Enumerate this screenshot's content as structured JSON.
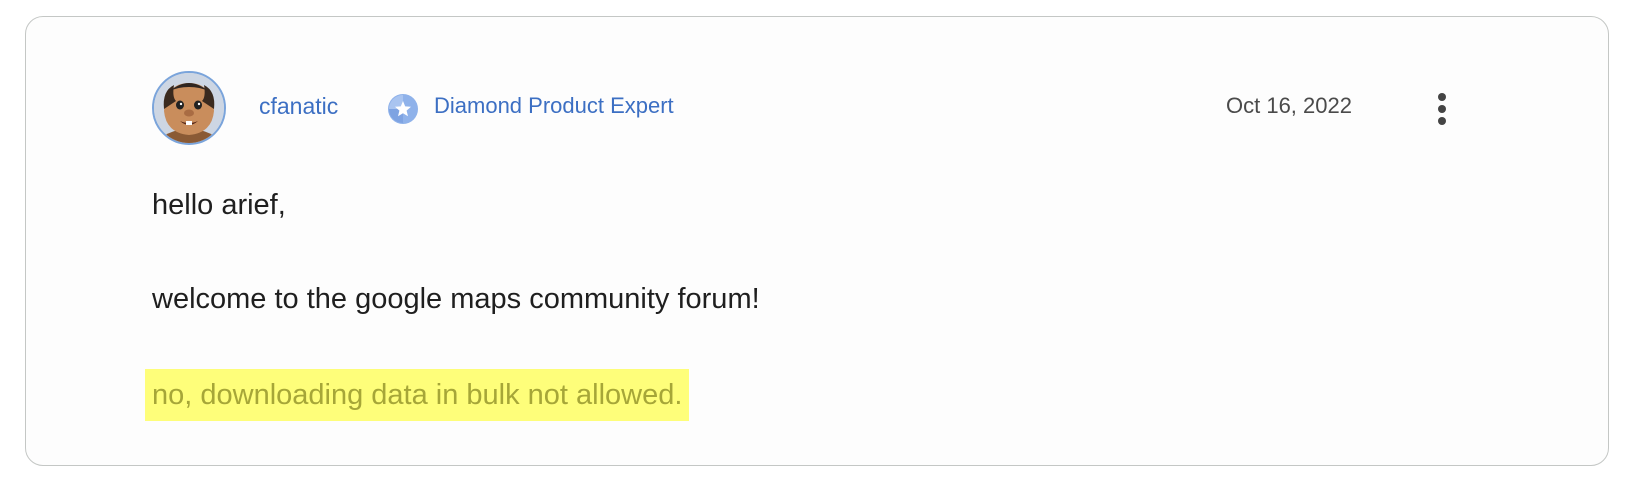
{
  "post": {
    "author": {
      "username": "cfanatic",
      "badge_label": "Diamond Product Expert",
      "badge_icon": "star-badge-icon",
      "avatar_icon": "cartoon-avatar"
    },
    "date": "Oct 16, 2022",
    "menu_icon": "more-vertical-icon",
    "body": {
      "line1": "hello arief,",
      "line2": "welcome to the google maps community forum!",
      "line3": "no, downloading data in bulk not allowed."
    }
  },
  "colors": {
    "link": "#3c6fc3",
    "highlight_bg": "#fefe7a",
    "highlight_text": "#a6a638",
    "border": "#c4c7c5"
  }
}
